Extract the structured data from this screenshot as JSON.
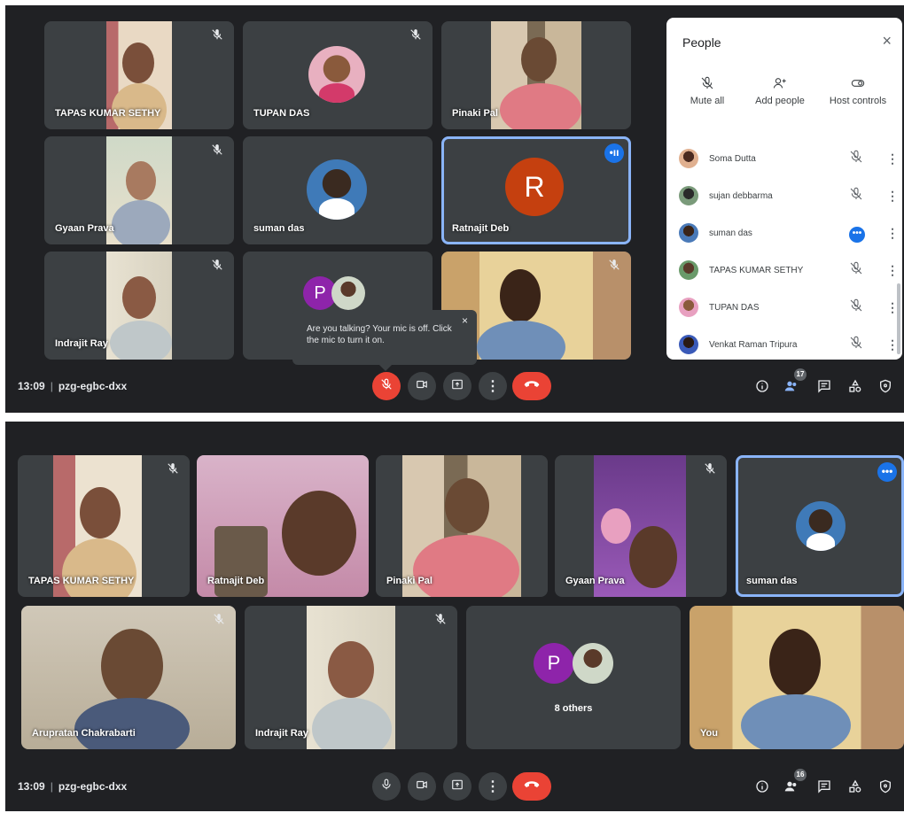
{
  "top": {
    "tiles": [
      {
        "name": "TAPAS KUMAR SETHY"
      },
      {
        "name": "TUPAN DAS"
      },
      {
        "name": "Pinaki Pal"
      },
      {
        "name": "Gyaan Prava"
      },
      {
        "name": "suman das"
      },
      {
        "name": "Ratnajit Deb",
        "avatar_letter": "R"
      },
      {
        "name": "Indrajit Ray"
      },
      {
        "name": "",
        "avatar_letter": "P"
      },
      {
        "name": ""
      }
    ],
    "toast": {
      "text": "Are you talking? Your mic is off. Click the mic to turn it on.",
      "close": "×"
    },
    "people": {
      "title": "People",
      "close": "×",
      "actions": [
        {
          "label": "Mute all",
          "icon": "mic-off-icon"
        },
        {
          "label": "Add people",
          "icon": "add-person-icon"
        },
        {
          "label": "Host controls",
          "icon": "toggle-icon"
        }
      ],
      "participants": [
        {
          "name": "Soma Dutta",
          "status": "muted"
        },
        {
          "name": "sujan debbarma",
          "status": "muted"
        },
        {
          "name": "suman das",
          "status": "speaking"
        },
        {
          "name": "TAPAS KUMAR SETHY",
          "status": "muted"
        },
        {
          "name": "TUPAN DAS",
          "status": "muted"
        },
        {
          "name": "Venkat Raman Tripura",
          "status": "muted"
        }
      ]
    },
    "bar": {
      "time": "13:09",
      "separator": "|",
      "code": "pzg-egbc-dxx",
      "people_count": "17"
    }
  },
  "bottom": {
    "tiles": [
      {
        "name": "TAPAS KUMAR SETHY"
      },
      {
        "name": "Ratnajit Deb"
      },
      {
        "name": "Pinaki Pal"
      },
      {
        "name": "Gyaan Prava"
      },
      {
        "name": "suman das"
      },
      {
        "name": "Arupratan Chakrabarti"
      },
      {
        "name": "Indrajit Ray"
      },
      {
        "name": "8 others",
        "avatar_letter": "P"
      },
      {
        "name": "You"
      }
    ],
    "bar": {
      "time": "13:09",
      "separator": "|",
      "code": "pzg-egbc-dxx",
      "people_count": "16"
    }
  },
  "colors": {
    "bg": "#202124",
    "tile": "#3c4043",
    "accent": "#8ab4f8",
    "red": "#ea4335",
    "blue": "#1a73e8",
    "purple": "#8e24aa",
    "orange": "#c5400f"
  }
}
